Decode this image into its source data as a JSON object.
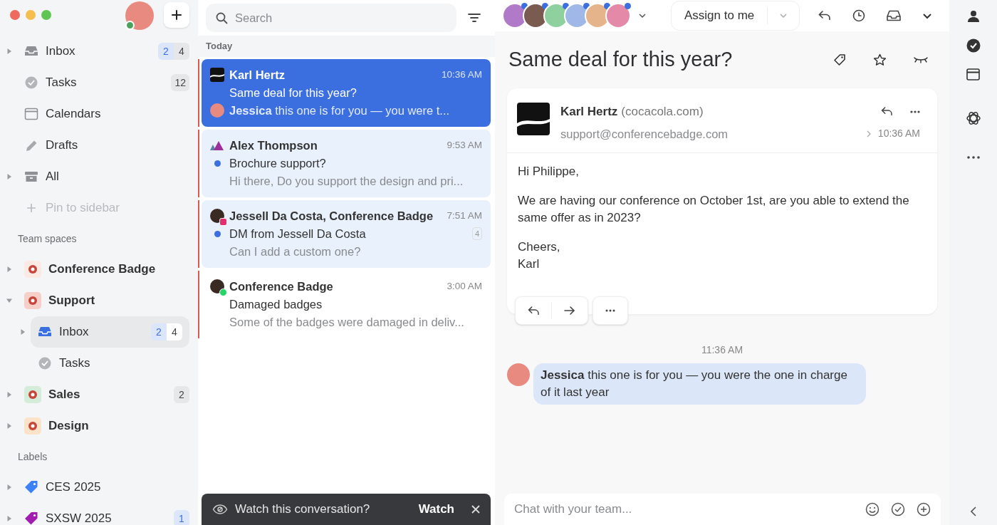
{
  "sidebar": {
    "sections": [
      {
        "items": [
          {
            "kind": "inbox",
            "label": "Inbox",
            "expanded": false,
            "selected": false,
            "badges": [
              {
                "text": "2",
                "kind": "blue"
              },
              {
                "text": "4",
                "kind": "grey"
              }
            ]
          },
          {
            "kind": "check",
            "label": "Tasks",
            "selected": false,
            "badges": [
              {
                "text": "12",
                "kind": "grey"
              }
            ]
          },
          {
            "kind": "calendar",
            "label": "Calendars",
            "selected": false
          },
          {
            "kind": "pencil",
            "label": "Drafts",
            "selected": false
          },
          {
            "kind": "archive",
            "label": "All",
            "expanded": false,
            "selected": false
          },
          {
            "kind": "add",
            "label": "Pin to sidebar",
            "selected": false
          }
        ]
      },
      {
        "heading": "Team spaces",
        "items": [
          {
            "kind": "space",
            "label": "Conference Badge",
            "color": "#fbe9e4",
            "expanded": false,
            "selected": false
          },
          {
            "kind": "space",
            "label": "Support",
            "color": "#f5cfc8",
            "expanded": true,
            "selected": false,
            "children": [
              {
                "kind": "inbox",
                "label": "Inbox",
                "expanded": false,
                "selected": true,
                "badges": [
                  {
                    "text": "2",
                    "kind": "blue"
                  },
                  {
                    "text": "4",
                    "kind": "grey"
                  }
                ]
              },
              {
                "kind": "check",
                "label": "Tasks",
                "selected": false
              }
            ]
          },
          {
            "kind": "space",
            "label": "Sales",
            "color": "#d4ecd9",
            "expanded": false,
            "selected": false,
            "badges": [
              {
                "text": "2",
                "kind": "grey"
              }
            ]
          },
          {
            "kind": "space",
            "label": "Design",
            "color": "#fbe3c9",
            "expanded": false,
            "selected": false
          }
        ]
      },
      {
        "heading": "Labels",
        "items": [
          {
            "kind": "tag",
            "label": "CES 2025",
            "color": "#3b82f6",
            "expanded": false,
            "selected": false
          },
          {
            "kind": "tag",
            "label": "SXSW 2025",
            "color": "#a21caf",
            "expanded": false,
            "selected": false,
            "badges": [
              {
                "text": "1",
                "kind": "blue"
              }
            ]
          }
        ]
      }
    ]
  },
  "list": {
    "search": {
      "placeholder": "Search"
    },
    "group": "Today",
    "conversations": [
      {
        "kind": "logo",
        "sender": "Karl Hertz",
        "time": "10:36 AM",
        "subject": "Same deal for this year?",
        "preview": "**Jessica** this one is for you — you were t...",
        "preview_avatar": true,
        "unread": false,
        "selected": true,
        "marked": true
      },
      {
        "kind": "triangles",
        "sender": "Alex Thompson",
        "time": "9:53 AM",
        "subject": "Brochure support?",
        "preview": "Hi there, Do you support the design and pri...",
        "unread": true,
        "selected": false,
        "marked": true
      },
      {
        "kind": "photo-instagram",
        "sender": "Jessell Da Costa, Conference Badge",
        "time": "7:51 AM",
        "subject": "DM from Jessell Da Costa",
        "preview": "Can I add a custom one?",
        "count": "4",
        "unread": true,
        "selected": false,
        "marked": true
      },
      {
        "kind": "photo-whatsapp",
        "sender": "Conference Badge",
        "time": "3:00 AM",
        "subject": "Damaged badges",
        "preview": "Some of the badges were damaged in deliv...",
        "unread": false,
        "selected": false,
        "marked": true
      }
    ],
    "toast": {
      "text": "Watch this conversation?",
      "action": "Watch"
    }
  },
  "toolbar": {
    "participants": [
      {
        "dot": true
      },
      {
        "dot": true
      },
      {
        "dot": true
      },
      {
        "dot": true
      },
      {
        "dot": true
      },
      {
        "dot": true
      }
    ],
    "assign": "Assign to me"
  },
  "conversation": {
    "title": "Same deal for this year?",
    "message": {
      "sender": "Karl Hertz",
      "domain": "(cocacola.com)",
      "email": "support@conferencebadge.com",
      "time": "10:36 AM",
      "paragraphs": [
        [
          "Hi Philippe,"
        ],
        [
          "We are having our conference on October 1st, are you able to extend the same offer as in 2023?"
        ],
        [
          "Cheers,",
          "Karl"
        ]
      ]
    },
    "comments": [
      {
        "time": "11:36 AM",
        "text": "**Jessica** this one is for you — you were the one in charge of it last year"
      }
    ],
    "composer": {
      "placeholder": "Chat with your team..."
    }
  }
}
